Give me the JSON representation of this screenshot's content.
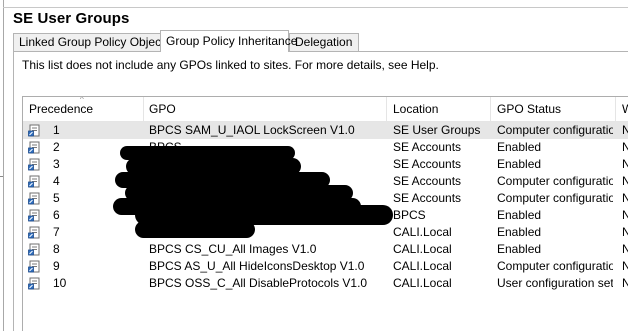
{
  "window": {
    "title": "SE User Groups"
  },
  "tabs": [
    {
      "label": "Linked Group Policy Objects",
      "active": false
    },
    {
      "label": "Group Policy Inheritance",
      "active": true
    },
    {
      "label": "Delegation",
      "active": false
    }
  ],
  "info_text": "This list does not include any GPOs linked to sites. For more details, see Help.",
  "table": {
    "columns": [
      "Precedence",
      "GPO",
      "Location",
      "GPO Status",
      "W"
    ],
    "sorted_column": "Precedence",
    "rows": [
      {
        "precedence": "1",
        "gpo": "BPCS SAM_U_IAOL LockScreen V1.0",
        "location": "SE User Groups",
        "status": "Computer configuratio...",
        "wmi": "N"
      },
      {
        "precedence": "2",
        "gpo": "BPCS",
        "location": "SE Accounts",
        "status": "Enabled",
        "wmi": "N"
      },
      {
        "precedence": "3",
        "gpo": "",
        "location": "SE Accounts",
        "status": "Enabled",
        "wmi": "N"
      },
      {
        "precedence": "4",
        "gpo": "",
        "location": "SE Accounts",
        "status": "Computer configuratio...",
        "wmi": "N"
      },
      {
        "precedence": "5",
        "gpo": "",
        "location": "SE Accounts",
        "status": "Computer configuratio...",
        "wmi": "N"
      },
      {
        "precedence": "6",
        "gpo": "",
        "location": "BPCS",
        "status": "Enabled",
        "wmi": "N"
      },
      {
        "precedence": "7",
        "gpo": "",
        "location": "CALI.Local",
        "status": "Enabled",
        "wmi": "N"
      },
      {
        "precedence": "8",
        "gpo": "BPCS CS_CU_All Images V1.0",
        "location": "CALI.Local",
        "status": "Enabled",
        "wmi": "N"
      },
      {
        "precedence": "9",
        "gpo": "BPCS AS_U_All HideIconsDesktop V1.0",
        "location": "CALI.Local",
        "status": "Computer configuratio...",
        "wmi": "N"
      },
      {
        "precedence": "10",
        "gpo": "BPCS OSS_C_All DisableProtocols V1.0",
        "location": "CALI.Local",
        "status": "User configuration set...",
        "wmi": "N"
      }
    ]
  },
  "selected_row": "1",
  "icons": {
    "row_icon": "gpo-scroll-icon",
    "sort_icon": "sort-ascending-icon"
  }
}
